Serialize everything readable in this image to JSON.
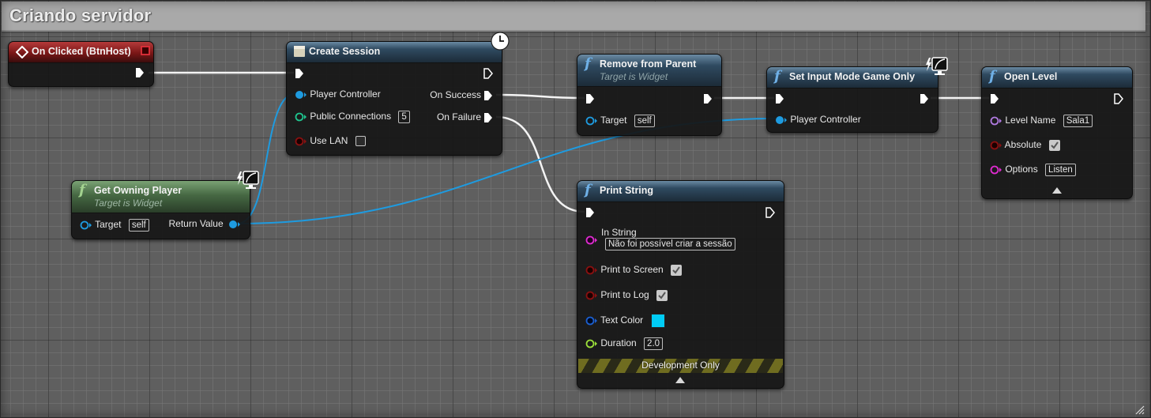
{
  "comment": {
    "title": "Criando servidor"
  },
  "colors": {
    "exec_wire": "#ffffff",
    "object_wire": "#1e9be0",
    "event_header": "#8a1c1c",
    "function_header": "#2f4a60",
    "pure_function_header": "#466843",
    "text_color_value": "#00ccf5"
  },
  "nodes": {
    "on_clicked": {
      "title": "On Clicked (BtnHost)",
      "icon": "event-diamond-icon"
    },
    "create_session": {
      "title": "Create Session",
      "icon": "async-clock-icon",
      "inputs": [
        {
          "label": "Player Controller",
          "type": "object"
        },
        {
          "label": "Public Connections",
          "type": "int",
          "value": "5"
        },
        {
          "label": "Use LAN",
          "type": "bool",
          "checked": false
        }
      ],
      "outputs": [
        {
          "label": "On Success",
          "type": "exec"
        },
        {
          "label": "On Failure",
          "type": "exec"
        }
      ]
    },
    "get_owning_player": {
      "title": "Get Owning Player",
      "subtitle": "Target is Widget",
      "inputs": [
        {
          "label": "Target",
          "value": "self"
        }
      ],
      "outputs": [
        {
          "label": "Return Value"
        }
      ]
    },
    "remove_from_parent": {
      "title": "Remove from Parent",
      "subtitle": "Target is Widget",
      "inputs": [
        {
          "label": "Target",
          "value": "self"
        }
      ]
    },
    "set_input_mode": {
      "title": "Set Input Mode Game Only",
      "inputs": [
        {
          "label": "Player Controller"
        }
      ]
    },
    "open_level": {
      "title": "Open Level",
      "inputs": [
        {
          "label": "Level Name",
          "value": "Sala1"
        },
        {
          "label": "Absolute",
          "checked": true
        },
        {
          "label": "Options",
          "value": "Listen"
        }
      ]
    },
    "print_string": {
      "title": "Print String",
      "inputs": [
        {
          "label": "In String",
          "value": "Não foi possível criar a sessão"
        },
        {
          "label": "Print to Screen",
          "checked": true
        },
        {
          "label": "Print to Log",
          "checked": true
        },
        {
          "label": "Text Color",
          "value": "#00ccf5"
        },
        {
          "label": "Duration",
          "value": "2.0"
        }
      ],
      "footer": "Development Only"
    }
  }
}
